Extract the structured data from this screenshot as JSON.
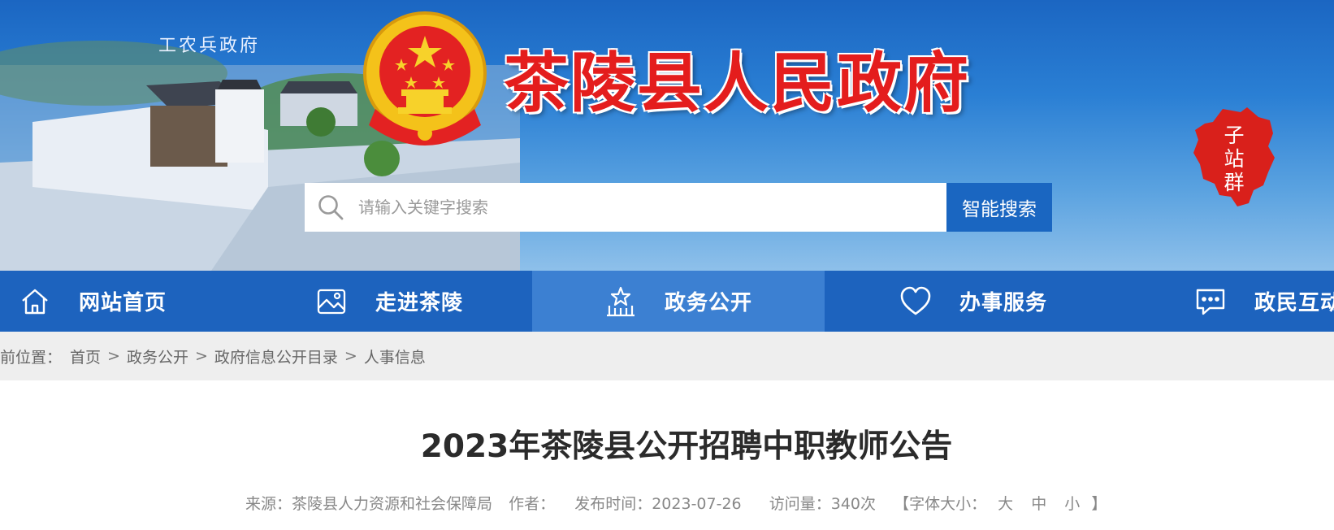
{
  "banner": {
    "slogan": "工农兵政府",
    "site_title": "茶陵县人民政府",
    "subsite_label": "子站群"
  },
  "search": {
    "placeholder": "请输入关键字搜索",
    "button_label": "智能搜索"
  },
  "nav": {
    "items": [
      {
        "label": "网站首页",
        "icon": "home-icon"
      },
      {
        "label": "走进茶陵",
        "icon": "picture-icon"
      },
      {
        "label": "政务公开",
        "icon": "government-building-icon",
        "active": true
      },
      {
        "label": "办事服务",
        "icon": "heart-icon"
      },
      {
        "label": "政民互动",
        "icon": "chat-bubble-icon"
      }
    ]
  },
  "breadcrumb": {
    "prefix": "前位置：",
    "items": [
      "首页",
      "政务公开",
      "政府信息公开目录",
      "人事信息"
    ],
    "separator": ">"
  },
  "article": {
    "title": "2023年茶陵县公开招聘中职教师公告",
    "source": "来源：茶陵县人力资源和社会保障局",
    "author": "作者：",
    "publish_time": "发布时间：2023-07-26",
    "views": "访问量：340次",
    "font_size_open": "【字体大小：",
    "font_size_large": "大",
    "font_size_medium": "中",
    "font_size_small": "小",
    "font_size_close": "】"
  },
  "colors": {
    "banner_blue": "#1b66c2",
    "nav_blue": "#1d63be",
    "nav_active": "#3c80d2",
    "title_red": "#e41d1d"
  }
}
